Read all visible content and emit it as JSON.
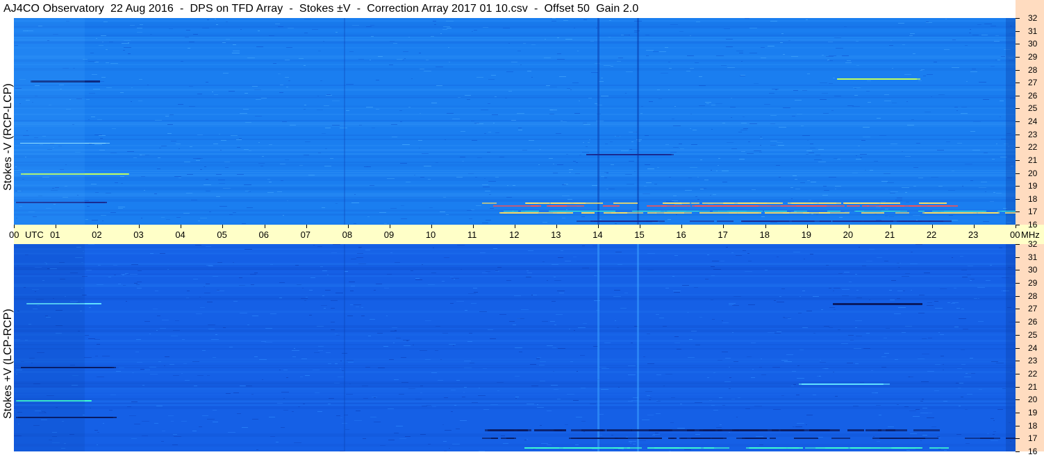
{
  "title": "AJ4CO Observatory  22 Aug 2016  -  DPS on TFD Array  -  Stokes ±V  -  Correction Array 2017 01 10.csv  -  Offset 50  Gain 2.0",
  "panels": {
    "top": {
      "label": "Stokes -V (RCP-LCP)",
      "color": "#1a7ef0"
    },
    "bottom": {
      "label": "Stokes +V (LCP-RCP)",
      "color": "#1560e6"
    }
  },
  "colors": {
    "time_band": "#ffffc8",
    "freq_strip": "#ffdcc0"
  },
  "chart_data": {
    "type": "heatmap",
    "x_ticks": [
      "00",
      "01",
      "02",
      "03",
      "04",
      "05",
      "06",
      "07",
      "08",
      "09",
      "10",
      "11",
      "12",
      "13",
      "14",
      "15",
      "16",
      "17",
      "18",
      "19",
      "20",
      "21",
      "22",
      "23",
      "00"
    ],
    "x_unit": "UTC",
    "y_ticks": [
      "16",
      "17",
      "18",
      "19",
      "20",
      "21",
      "22",
      "23",
      "24",
      "25",
      "26",
      "27",
      "28",
      "29",
      "30",
      "31",
      "32"
    ],
    "y_unit": "MHz",
    "xlim": [
      0,
      24
    ],
    "ylim": [
      16,
      32
    ]
  }
}
